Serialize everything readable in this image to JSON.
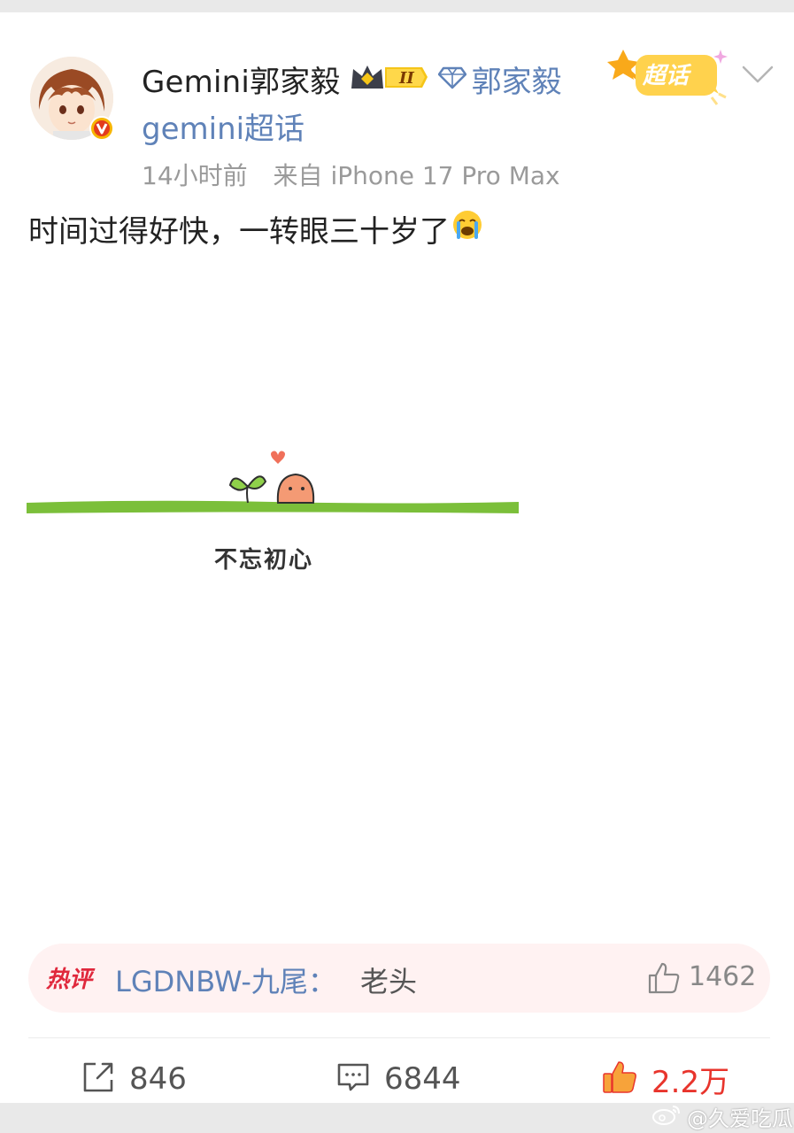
{
  "post": {
    "username": "Gemini郭家毅",
    "linked_name": "郭家毅",
    "topic_link": "gemini超话",
    "chaohua_badge": "超话",
    "time": "14小时前",
    "source": "来自 iPhone 17 Pro Max",
    "text": "时间过得好快，一转眼三十岁了",
    "emoji": "crying-face-emoji",
    "image_caption": "不忘初心"
  },
  "hot_comment": {
    "label": "热评",
    "commenter": "LGDNBW-九尾：",
    "text": "老头",
    "likes": "1462"
  },
  "actions": {
    "reposts": "846",
    "comments": "6844",
    "likes": "2.2万"
  },
  "watermark": "@久爱吃瓜",
  "colors": {
    "link_blue": "#5f82b8",
    "like_red": "#e8342c",
    "hot_label_red": "#e0283c",
    "grass_green": "#7bbf3a"
  }
}
